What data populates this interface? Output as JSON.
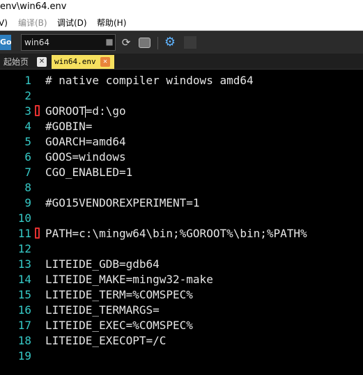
{
  "window": {
    "title_fragment": "env\\win64.env"
  },
  "menu": {
    "items": [
      {
        "id": "view",
        "label": "V)"
      },
      {
        "id": "build",
        "label": "编译(B)"
      },
      {
        "id": "debug",
        "label": "调试(D)"
      },
      {
        "id": "help",
        "label": "帮助(H)"
      }
    ]
  },
  "toolbar": {
    "go_label": "Go",
    "env_value": "win64",
    "refresh_icon": "refresh-icon",
    "gear_icon": "gear-icon"
  },
  "tabs": [
    {
      "label": "起始页",
      "active": false
    },
    {
      "label": "win64.env",
      "active": true
    }
  ],
  "editor": {
    "lines": [
      {
        "num": "1",
        "text": "# native compiler windows amd64",
        "marked": false
      },
      {
        "num": "2",
        "text": "",
        "marked": false
      },
      {
        "num": "3",
        "text": "GOROOT=d:\\go",
        "marked": true
      },
      {
        "num": "4",
        "text": "#GOBIN=",
        "marked": false
      },
      {
        "num": "5",
        "text": "GOARCH=amd64",
        "marked": false
      },
      {
        "num": "6",
        "text": "GOOS=windows",
        "marked": false
      },
      {
        "num": "7",
        "text": "CGO_ENABLED=1",
        "marked": false
      },
      {
        "num": "8",
        "text": "",
        "marked": false
      },
      {
        "num": "9",
        "text": "#GO15VENDOREXPERIMENT=1",
        "marked": false
      },
      {
        "num": "10",
        "text": "",
        "marked": false
      },
      {
        "num": "11",
        "text": "PATH=c:\\mingw64\\bin;%GOROOT%\\bin;%PATH%",
        "marked": true
      },
      {
        "num": "12",
        "text": "",
        "marked": false
      },
      {
        "num": "13",
        "text": "LITEIDE_GDB=gdb64",
        "marked": false
      },
      {
        "num": "14",
        "text": "LITEIDE_MAKE=mingw32-make",
        "marked": false
      },
      {
        "num": "15",
        "text": "LITEIDE_TERM=%COMSPEC%",
        "marked": false
      },
      {
        "num": "16",
        "text": "LITEIDE_TERMARGS=",
        "marked": false
      },
      {
        "num": "17",
        "text": "LITEIDE_EXEC=%COMSPEC%",
        "marked": false
      },
      {
        "num": "18",
        "text": "LITEIDE_EXECOPT=/C",
        "marked": false
      },
      {
        "num": "19",
        "text": "",
        "marked": false
      }
    ]
  },
  "colors": {
    "line_number": "#36c9c6",
    "code_text": "#e6e6e6",
    "marker": "#e53030",
    "active_tab": "#f6e05e",
    "background": "#000000"
  }
}
